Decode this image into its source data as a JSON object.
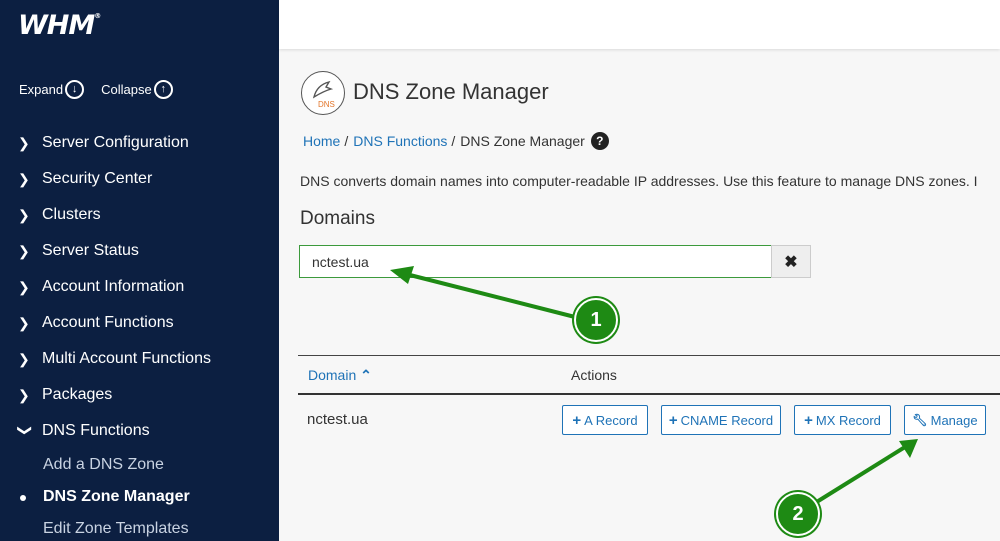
{
  "app": {
    "logo": "WHM",
    "logo_mark": "®"
  },
  "sidebar": {
    "expand": "Expand",
    "collapse": "Collapse",
    "items": [
      {
        "label": "Server Configuration"
      },
      {
        "label": "Security Center"
      },
      {
        "label": "Clusters"
      },
      {
        "label": "Server Status"
      },
      {
        "label": "Account Information"
      },
      {
        "label": "Account Functions"
      },
      {
        "label": "Multi Account Functions"
      },
      {
        "label": "Packages"
      },
      {
        "label": "DNS Functions"
      }
    ],
    "subitems": [
      {
        "label": "Add a DNS Zone"
      },
      {
        "label": "DNS Zone Manager"
      },
      {
        "label": "Edit Zone Templates"
      }
    ]
  },
  "page": {
    "icon_label": "DNS",
    "title": "DNS Zone Manager",
    "breadcrumb": {
      "home": "Home",
      "section": "DNS Functions",
      "current": "DNS Zone Manager",
      "sep": "/"
    },
    "description": "DNS converts domain names into computer-readable IP addresses. Use this feature to manage DNS zones. I",
    "domains_heading": "Domains",
    "search": {
      "value": "nctest.ua"
    },
    "table": {
      "col_domain": "Domain",
      "col_actions": "Actions",
      "rows": [
        {
          "domain": "nctest.ua"
        }
      ]
    },
    "buttons": {
      "a_record": "A Record",
      "cname_record": "CNAME Record",
      "mx_record": "MX Record",
      "manage": "Manage"
    }
  },
  "annotations": {
    "step1": "1",
    "step2": "2",
    "color": "#1e8a14"
  }
}
